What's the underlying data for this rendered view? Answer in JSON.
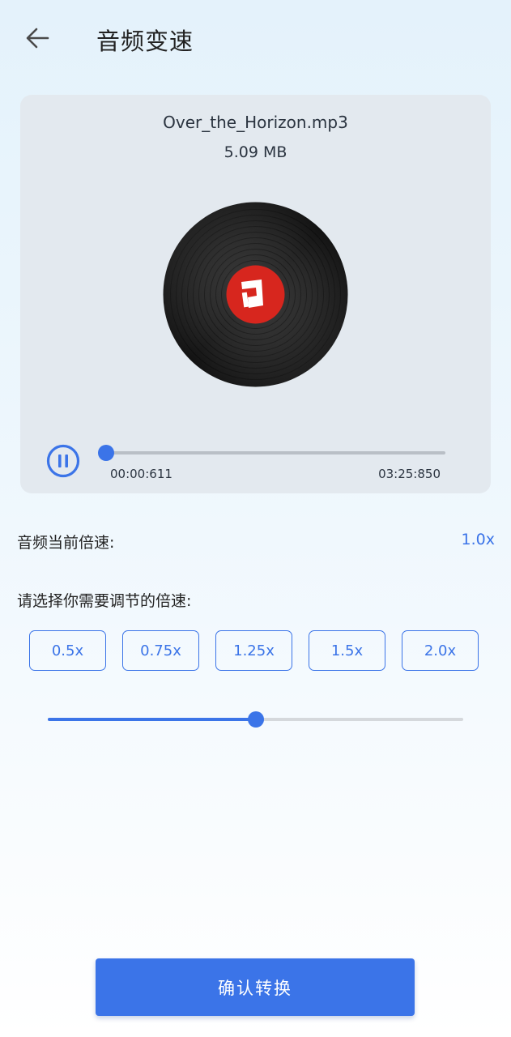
{
  "header": {
    "back_icon": "arrow-left-icon",
    "title": "音频变速"
  },
  "player": {
    "file_name": "Over_the_Horizon.mp3",
    "file_size": "5.09 MB",
    "disc_icon": "vinyl-record-icon",
    "play_state_icon": "pause-circle-icon",
    "current_time": "00:00:611",
    "total_time": "03:25:850",
    "progress_fraction": 0.003
  },
  "speed": {
    "current_label": "音频当前倍速:",
    "current_value": "1.0x",
    "choose_label": "请选择你需要调节的倍速:",
    "presets": [
      "0.5x",
      "0.75x",
      "1.25x",
      "1.5x",
      "2.0x"
    ],
    "slider_fraction": 0.5
  },
  "actions": {
    "confirm_label": "确认转换"
  },
  "colors": {
    "accent": "#3b74e8",
    "card_bg": "#e3e9ef",
    "label_red": "#d7261e"
  }
}
